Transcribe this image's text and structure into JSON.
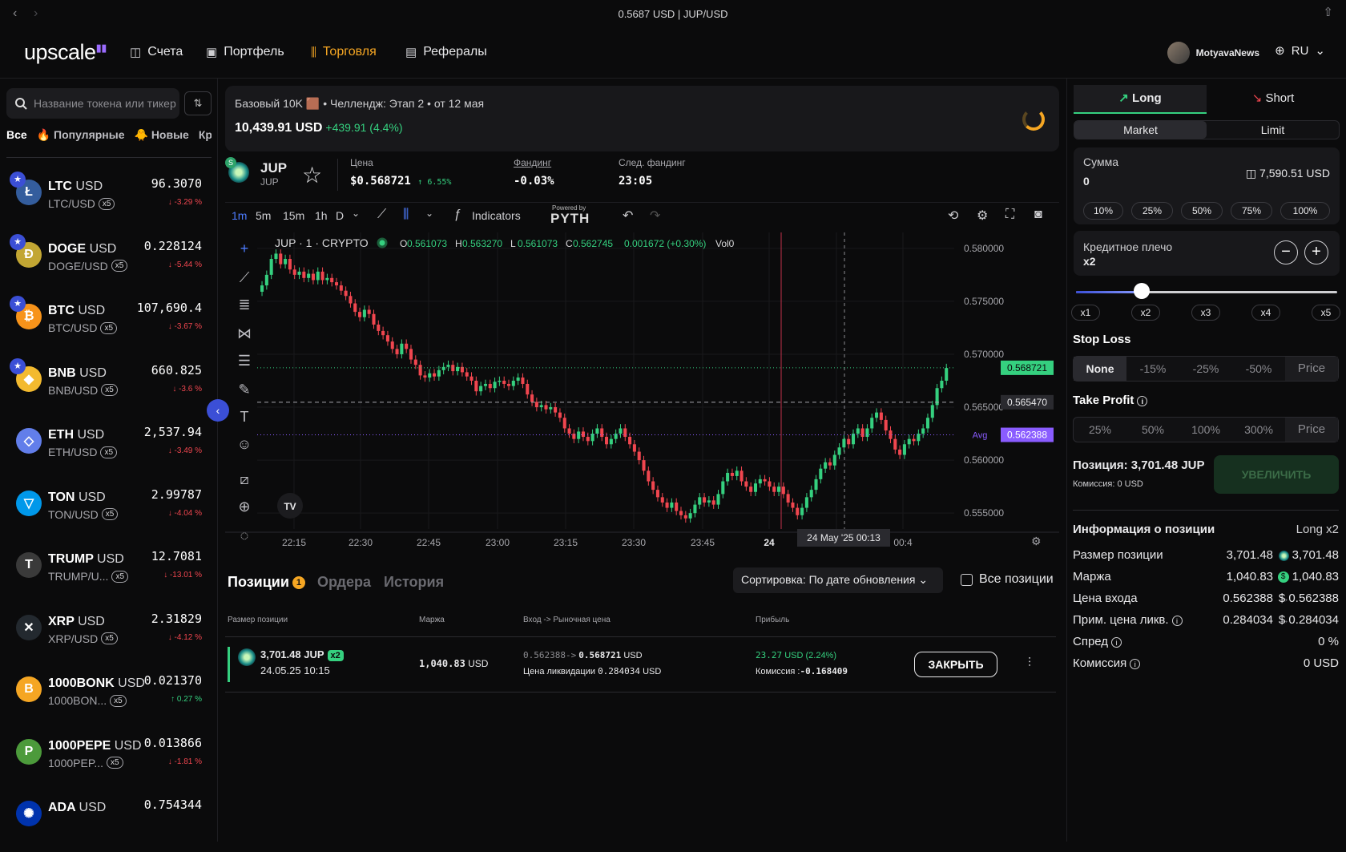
{
  "browser": {
    "title": "0.5687 USD | JUP/USD"
  },
  "nav": {
    "logo": "upscale",
    "accounts": "Счета",
    "portfolio": "Портфель",
    "trade": "Торговля",
    "referrals": "Рефералы",
    "username": "MotyavaNews",
    "language": "RU"
  },
  "sidebar": {
    "search_placeholder": "Название токена или тикер",
    "filters": [
      "Все",
      "🔥 Популярные",
      "🐥 Новые",
      "Кр"
    ],
    "coins": [
      {
        "sym": "LTC",
        "quote": "USD",
        "pair": "LTC/USD",
        "lev": "x5",
        "price": "96.3070",
        "chg": "↓ -3.29 %",
        "dir": "down",
        "fav": true,
        "color": "#345d9d",
        "glyph": "Ł"
      },
      {
        "sym": "DOGE",
        "quote": "USD",
        "pair": "DOGE/USD",
        "lev": "x5",
        "price": "0.228124",
        "chg": "↓ -5.44 %",
        "dir": "down",
        "fav": true,
        "color": "#c2a633",
        "glyph": "Ð"
      },
      {
        "sym": "BTC",
        "quote": "USD",
        "pair": "BTC/USD",
        "lev": "x5",
        "price": "107,690.4",
        "chg": "↓ -3.67 %",
        "dir": "down",
        "fav": true,
        "color": "#f7931a",
        "glyph": "₿"
      },
      {
        "sym": "BNB",
        "quote": "USD",
        "pair": "BNB/USD",
        "lev": "x5",
        "price": "660.825",
        "chg": "↓ -3.6 %",
        "dir": "down",
        "fav": true,
        "color": "#f3ba2f",
        "glyph": "◆"
      },
      {
        "sym": "ETH",
        "quote": "USD",
        "pair": "ETH/USD",
        "lev": "x5",
        "price": "2,537.94",
        "chg": "↓ -3.49 %",
        "dir": "down",
        "fav": false,
        "color": "#627eea",
        "glyph": "◇"
      },
      {
        "sym": "TON",
        "quote": "USD",
        "pair": "TON/USD",
        "lev": "x5",
        "price": "2.99787",
        "chg": "↓ -4.04 %",
        "dir": "down",
        "fav": false,
        "color": "#0098ea",
        "glyph": "▽"
      },
      {
        "sym": "TRUMP",
        "quote": "USD",
        "pair": "TRUMP/U...",
        "lev": "x5",
        "price": "12.7081",
        "chg": "↓ -13.01 %",
        "dir": "down",
        "fav": false,
        "color": "#3a3a3a",
        "glyph": "T"
      },
      {
        "sym": "XRP",
        "quote": "USD",
        "pair": "XRP/USD",
        "lev": "x5",
        "price": "2.31829",
        "chg": "↓ -4.12 %",
        "dir": "down",
        "fav": false,
        "color": "#23292f",
        "glyph": "✕"
      },
      {
        "sym": "1000BONK",
        "quote": "USD",
        "pair": "1000BON...",
        "lev": "x5",
        "price": "0.021370",
        "chg": "↑ 0.27 %",
        "dir": "up",
        "fav": false,
        "color": "#f5a623",
        "glyph": "B"
      },
      {
        "sym": "1000PEPE",
        "quote": "USD",
        "pair": "1000PEP...",
        "lev": "x5",
        "price": "0.013866",
        "chg": "↓ -1.81 %",
        "dir": "down",
        "fav": false,
        "color": "#4c9a3b",
        "glyph": "P"
      },
      {
        "sym": "ADA",
        "quote": "USD",
        "pair": "",
        "lev": "",
        "price": "0.754344",
        "chg": "",
        "dir": "down",
        "fav": false,
        "color": "#0033ad",
        "glyph": "✺"
      }
    ]
  },
  "challenge": {
    "title": "Базовый 10K 🟫 • Челлендж: Этап 2 • от 12 мая",
    "balance": "10,439.91 USD",
    "gain": "+439.91 (4.4%)"
  },
  "ticker": {
    "symbol": "JUP",
    "sub": "JUP",
    "price_label": "Цена",
    "price": "$0.568721",
    "price_change": "↑ 6.55%",
    "funding_label": "Фандинг",
    "funding": "-0.03%",
    "next_funding_label": "След. фандинг",
    "next_funding": "23:05"
  },
  "toolbar": {
    "timeframes": [
      "1m",
      "5m",
      "15m",
      "1h",
      "D"
    ],
    "indicators": "Indicators",
    "powered_by": "Powered by",
    "pyth": "PYTH"
  },
  "chart_legend": {
    "title": "JUP · 1 · CRYPTO",
    "o": "0.561073",
    "h": "0.563270",
    "l": "0.561073",
    "c": "0.562745",
    "change": "0.001672 (+0.30%)",
    "vol": "Vol0"
  },
  "chart_data": {
    "type": "candlestick",
    "y_ticks": [
      "0.580000",
      "0.575000",
      "0.570000",
      "0.565000",
      "0.560000",
      "0.555000"
    ],
    "ylim": [
      0.5535,
      0.5815
    ],
    "x_ticks": [
      "22:15",
      "22:30",
      "22:45",
      "23:00",
      "23:15",
      "23:30",
      "23:45",
      "24",
      "00:30",
      "00:4"
    ],
    "crosshair_label": "24 May '25   00:13",
    "price_labels": {
      "last": "0.568721",
      "cursor": "0.565470",
      "avg": "0.562388",
      "avg_text": "Avg"
    },
    "colors": {
      "up": "#35d07f",
      "down": "#f0464f"
    },
    "closes": [
      0.5765,
      0.5775,
      0.579,
      0.5795,
      0.5785,
      0.579,
      0.578,
      0.5775,
      0.5778,
      0.5772,
      0.5776,
      0.577,
      0.5778,
      0.577,
      0.5772,
      0.5768,
      0.5765,
      0.576,
      0.5755,
      0.5748,
      0.574,
      0.5735,
      0.5742,
      0.5738,
      0.5728,
      0.5722,
      0.5718,
      0.5712,
      0.5705,
      0.57,
      0.571,
      0.5705,
      0.5695,
      0.569,
      0.568,
      0.5678,
      0.5682,
      0.5679,
      0.5685,
      0.5688,
      0.569,
      0.5684,
      0.5688,
      0.5683,
      0.5679,
      0.5675,
      0.5665,
      0.567,
      0.5672,
      0.5668,
      0.5674,
      0.5675,
      0.5672,
      0.567,
      0.5675,
      0.5678,
      0.5672,
      0.5662,
      0.5655,
      0.565,
      0.5652,
      0.5648,
      0.565,
      0.5645,
      0.564,
      0.563,
      0.5625,
      0.562,
      0.5627,
      0.5622,
      0.5618,
      0.5625,
      0.563,
      0.5622,
      0.5615,
      0.562,
      0.5625,
      0.563,
      0.5622,
      0.5615,
      0.5608,
      0.56,
      0.559,
      0.558,
      0.5572,
      0.5565,
      0.556,
      0.5555,
      0.556,
      0.5552,
      0.5548,
      0.5545,
      0.555,
      0.5558,
      0.5565,
      0.556,
      0.5562,
      0.5558,
      0.5568,
      0.558,
      0.5588,
      0.5585,
      0.559,
      0.558,
      0.5575,
      0.557,
      0.5578,
      0.5582,
      0.558,
      0.5575,
      0.557,
      0.5575,
      0.5568,
      0.556,
      0.5555,
      0.5548,
      0.5555,
      0.5565,
      0.5572,
      0.5582,
      0.5592,
      0.5598,
      0.5595,
      0.5605,
      0.5612,
      0.562,
      0.5615,
      0.5625,
      0.563,
      0.5622,
      0.563,
      0.564,
      0.5645,
      0.5638,
      0.5628,
      0.562,
      0.561,
      0.5605,
      0.5615,
      0.562,
      0.5618,
      0.5625,
      0.563,
      0.564,
      0.5652,
      0.5668,
      0.5675,
      0.5687
    ]
  },
  "positions": {
    "tabs": [
      "Позиции",
      "Ордера",
      "История"
    ],
    "badge": "1",
    "sort": "Сортировка: По дате обновления",
    "all_positions": "Все позиции",
    "headers": [
      "Размер позиции",
      "Маржа",
      "Вход -> Рыночная цена",
      "Прибыль"
    ],
    "row": {
      "size": "3,701.48 JUP",
      "lev": "x2",
      "date": "24.05.25 10:15",
      "margin": "1,040.83",
      "margin_unit": "USD",
      "entry": "0.562388->",
      "market": "0.568721",
      "market_unit": "USD",
      "liq_label": "Цена ликвидации",
      "liq": "0.284034",
      "liq_unit": "USD",
      "pnl": "23.27",
      "pnl_unit": "USD",
      "pnl_pct": "(2.24%)",
      "fee_label": "Комиссия :",
      "fee": "-0.168409",
      "close": "ЗАКРЫТЬ"
    }
  },
  "order": {
    "long": "Long",
    "short": "Short",
    "market": "Market",
    "limit": "Limit",
    "amount_label": "Сумма",
    "amount_value": "0",
    "balance": "7,590.51 USD",
    "pcts": [
      "10%",
      "25%",
      "50%",
      "75%",
      "100%"
    ],
    "leverage_label": "Кредитное плечо",
    "leverage_value": "x2",
    "leverage_fraction": 0.25,
    "lev_marks": [
      "x1",
      "x2",
      "x3",
      "x4",
      "x5"
    ],
    "stop_loss_label": "Stop Loss",
    "sl_options": [
      "None",
      "-15%",
      "-25%",
      "-50%",
      "Price"
    ],
    "take_profit_label": "Take Profit",
    "tp_options": [
      "25%",
      "50%",
      "100%",
      "300%",
      "Price"
    ],
    "position_text": "Позиция: 3,701.48 JUP",
    "fee_text": "Комиссия: 0 USD",
    "increase": "УВЕЛИЧИТЬ"
  },
  "info": {
    "title": "Информация о позиции",
    "sub": "Long x2",
    "rows": [
      {
        "k": "Размер позиции",
        "a": "3,701.48",
        "b": "3,701.48"
      },
      {
        "k": "Маржа",
        "a": "1,040.83",
        "b": "1,040.83"
      },
      {
        "k": "Цена входа",
        "a": "0.562388",
        "b": "$ 0.562388"
      },
      {
        "k": "Прим. цена ликв.",
        "a": "0.284034",
        "b": "$ 0.284034"
      },
      {
        "k": "Спред",
        "a": "",
        "b": "0 %"
      },
      {
        "k": "Комиссия",
        "a": "",
        "b": "0 USD"
      }
    ]
  }
}
